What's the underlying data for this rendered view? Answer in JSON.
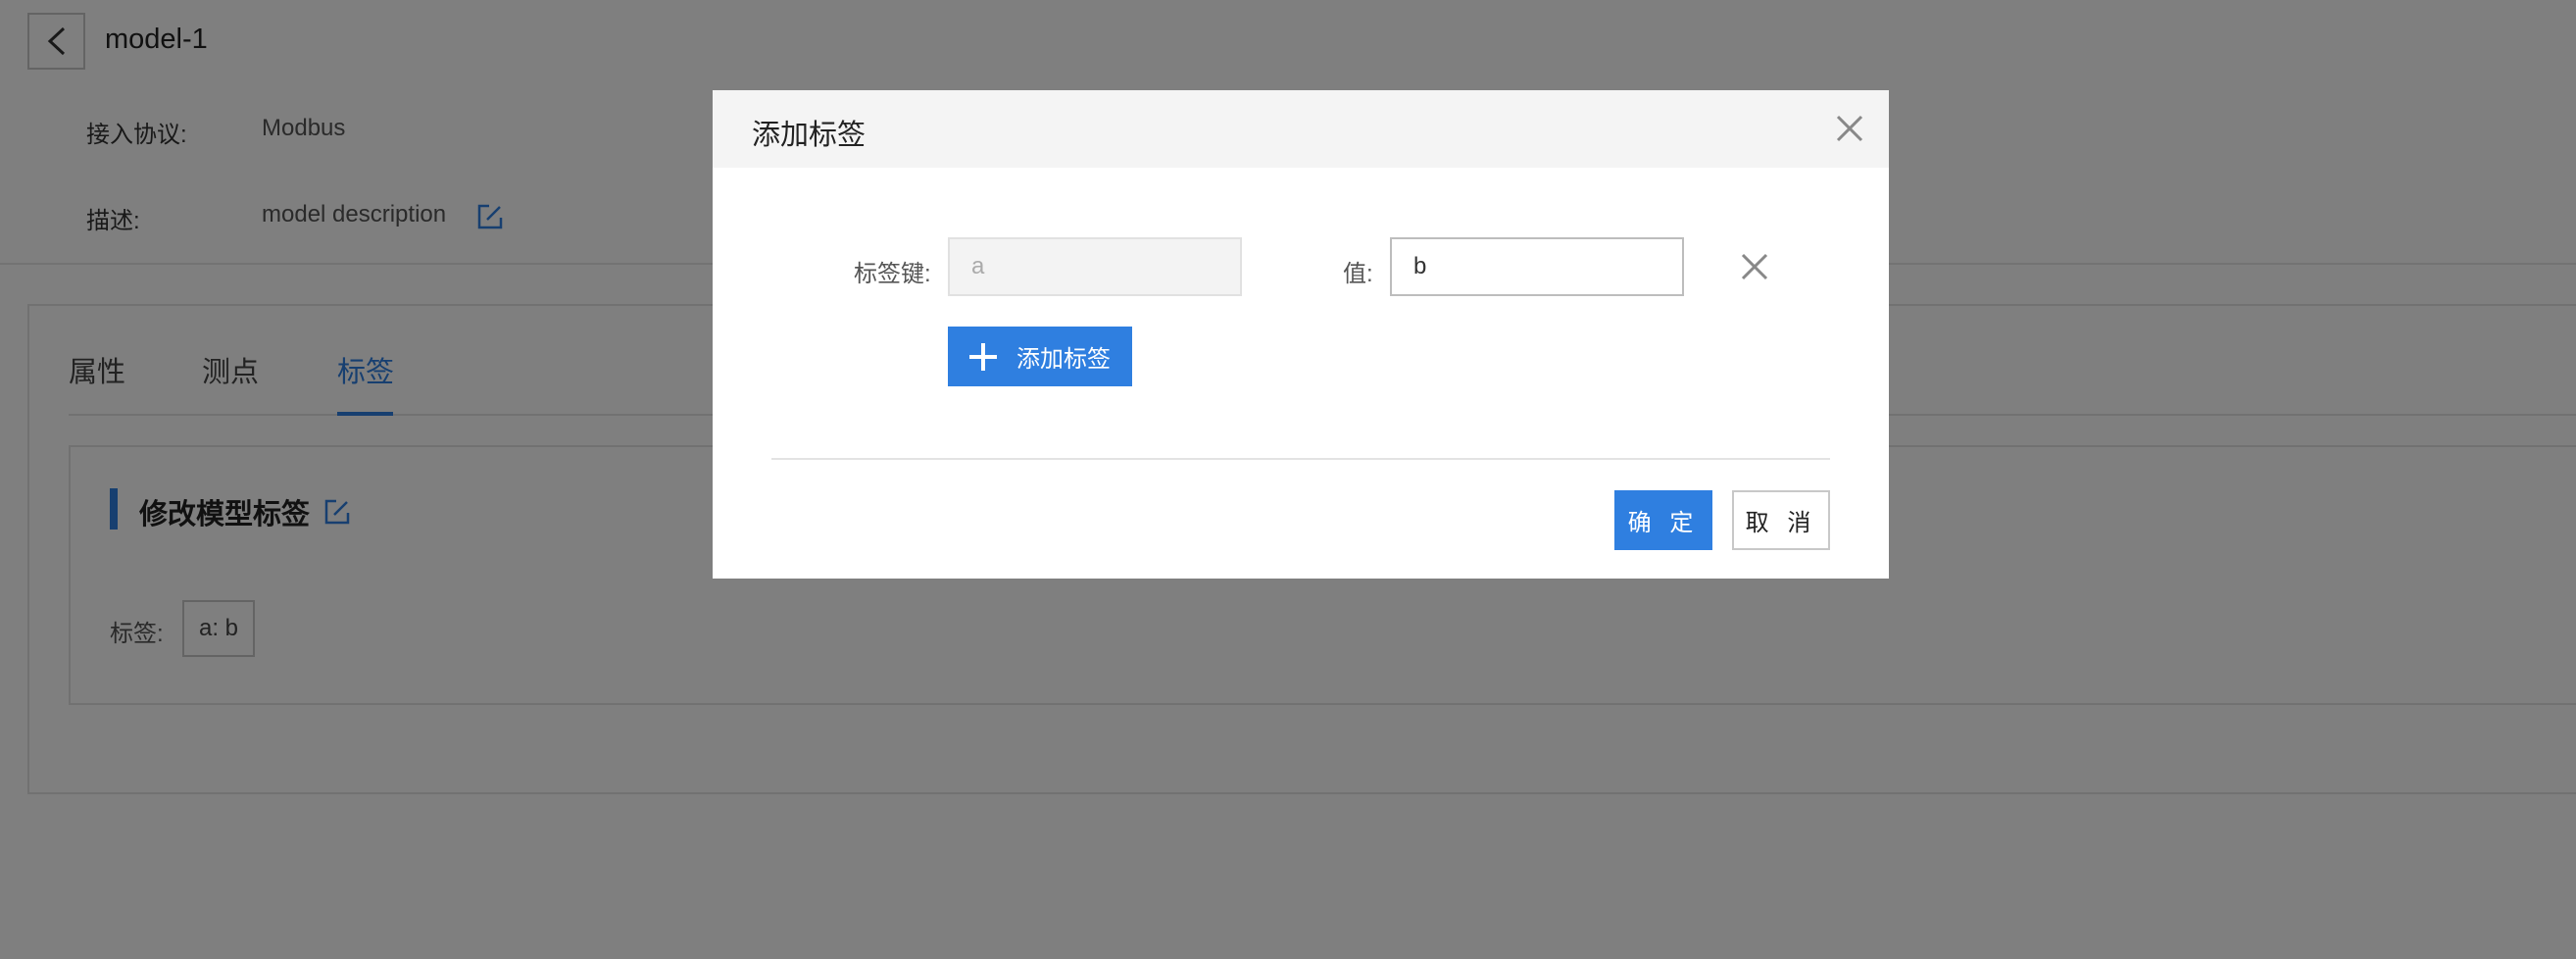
{
  "page": {
    "title": "model-1",
    "info": {
      "protocol_label": "接入协议:",
      "protocol_value": "Modbus",
      "description_label": "描述:",
      "description_value": "model description"
    },
    "tabs": [
      {
        "label": "属性",
        "active": false
      },
      {
        "label": "测点",
        "active": false
      },
      {
        "label": "标签",
        "active": true
      }
    ],
    "section_title": "修改模型标签",
    "tags_label": "标签:",
    "tag_chip": "a: b"
  },
  "modal": {
    "title": "添加标签",
    "key_label": "标签键:",
    "key_value": "a",
    "value_label": "值:",
    "value_value": "b",
    "add_button_label": "添加标签",
    "ok_label": "确 定",
    "cancel_label": "取 消"
  },
  "colors": {
    "accent": "#2f7fe0",
    "overlay": "rgba(0,0,0,0.5)"
  },
  "icons": {
    "back": "chevron-left-icon",
    "edit": "edit-icon",
    "close": "close-icon",
    "remove": "close-icon",
    "add": "plus-icon"
  }
}
